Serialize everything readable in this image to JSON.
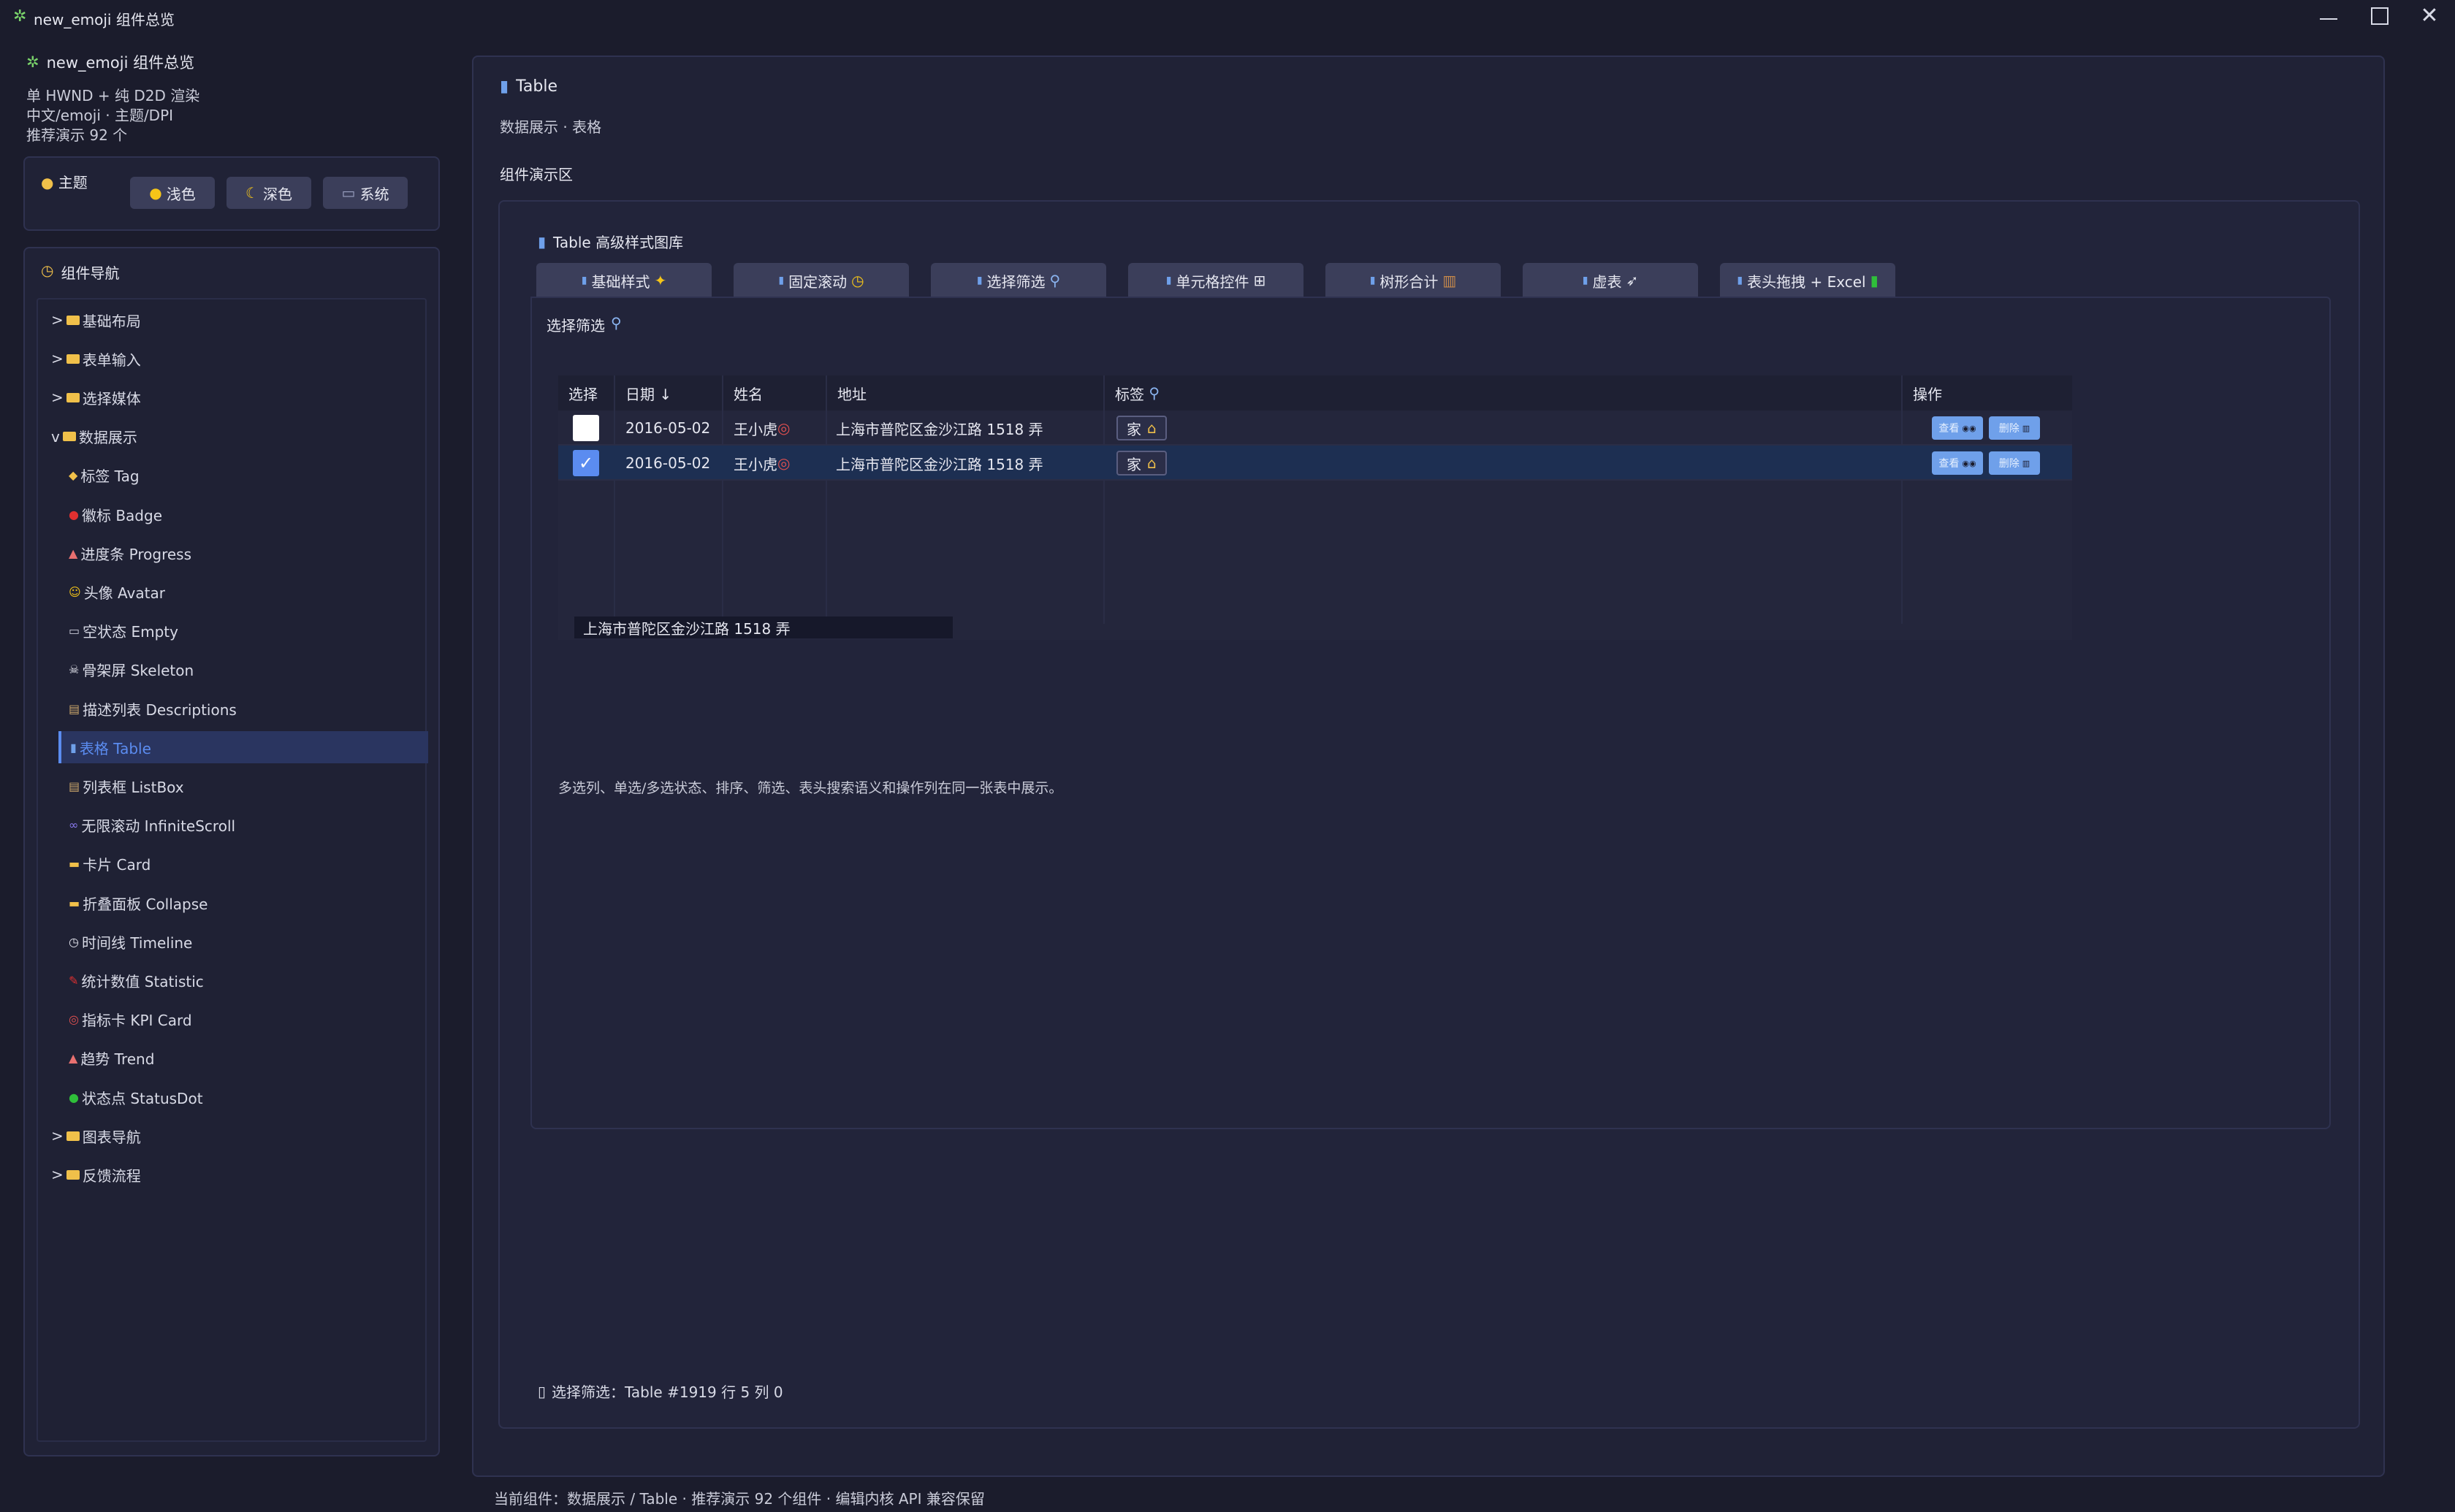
{
  "window": {
    "app_icon": "sparkle-icon",
    "title": "new_emoji 组件总览",
    "minimize": "minimize-icon",
    "maximize": "maximize-icon",
    "close": "close-icon"
  },
  "sidebar": {
    "app_name": "new_emoji 组件总览",
    "desc_lines": [
      "单 HWND + 纯 D2D 渲染",
      "中文/emoji · 主题/DPI",
      "推荐演示 92 个"
    ],
    "theme": {
      "label": "主题",
      "buttons": [
        "浅色",
        "深色",
        "系统"
      ]
    },
    "nav_header": "组件导航",
    "nav": [
      {
        "label": "基础布局",
        "prefix": ">"
      },
      {
        "label": "表单输入",
        "prefix": ">"
      },
      {
        "label": "选择媒体",
        "prefix": ">"
      },
      {
        "label": "数据展示",
        "prefix": "v"
      },
      {
        "label": "标签 Tag",
        "child": true,
        "icon": "tag-icon"
      },
      {
        "label": "徽标 Badge",
        "child": true,
        "icon": "red-dot-icon"
      },
      {
        "label": "进度条 Progress",
        "child": true,
        "icon": "chart-up-icon"
      },
      {
        "label": "头像 Avatar",
        "child": true,
        "icon": "smiley-icon"
      },
      {
        "label": "空状态 Empty",
        "child": true,
        "icon": "mailbox-icon"
      },
      {
        "label": "骨架屏 Skeleton",
        "child": true,
        "icon": "skull-icon"
      },
      {
        "label": "描述列表 Descriptions",
        "child": true,
        "icon": "clipboard-icon"
      },
      {
        "label": "表格 Table",
        "child": true,
        "icon": "bar-chart-icon",
        "active": true
      },
      {
        "label": "列表框 ListBox",
        "child": true,
        "icon": "clipboard-icon"
      },
      {
        "label": "无限滚动 InfiniteScroll",
        "child": true,
        "icon": "infinity-icon"
      },
      {
        "label": "卡片 Card",
        "child": true,
        "icon": "card-icon"
      },
      {
        "label": "折叠面板 Collapse",
        "child": true,
        "icon": "folder-icon"
      },
      {
        "label": "时间线 Timeline",
        "child": true,
        "icon": "clock-icon"
      },
      {
        "label": "统计数值 Statistic",
        "child": true,
        "icon": "pin-icon"
      },
      {
        "label": "指标卡 KPI Card",
        "child": true,
        "icon": "target-icon"
      },
      {
        "label": "趋势 Trend",
        "child": true,
        "icon": "chart-up-icon"
      },
      {
        "label": "状态点 StatusDot",
        "child": true,
        "icon": "green-dot-icon"
      },
      {
        "label": "图表导航",
        "prefix": ">"
      },
      {
        "label": "反馈流程",
        "prefix": ">"
      }
    ]
  },
  "main": {
    "title": "Table",
    "subtitle": "数据展示 · 表格",
    "demo_label": "组件演示区",
    "gallery_title": "Table 高级样式图库",
    "tabs": [
      {
        "label": "基础样式",
        "icon": "sparkles-icon"
      },
      {
        "label": "固定滚动",
        "icon": "clock-icon"
      },
      {
        "label": "选择筛选",
        "icon": "magnifier-icon"
      },
      {
        "label": "单元格控件",
        "icon": "grid-icon"
      },
      {
        "label": "树形合计",
        "icon": "abacus-icon"
      },
      {
        "label": "虚表",
        "icon": "rocket-icon"
      },
      {
        "label": "表头拖拽 + Excel",
        "icon": "green-book-icon"
      }
    ],
    "content_title": "选择筛选",
    "table": {
      "headers": [
        "选择",
        "日期 ↓",
        "姓名",
        "地址",
        "标签",
        "操作"
      ],
      "rows": [
        {
          "checked": false,
          "date": "2016-05-02",
          "name": "王小虎",
          "address": "上海市普陀区金沙江路 1518 弄",
          "tag": "家",
          "actions": [
            "查看",
            "删除"
          ]
        },
        {
          "checked": true,
          "date": "2016-05-02",
          "name": "王小虎",
          "address": "上海市普陀区金沙江路 1518 弄",
          "tag": "家",
          "actions": [
            "查看",
            "删除"
          ]
        }
      ],
      "tooltip": "上海市普陀区金沙江路 1518 弄"
    },
    "description": "多选列、单选/多选状态、排序、筛选、表头搜索语义和操作列在同一张表中展示。",
    "status": "选择筛选：Table #1919 行 5 列 0"
  },
  "footer": "当前组件：数据展示 / Table · 推荐演示 92 个组件 · 编辑内核 API 兼容保留",
  "colors": {
    "background": "#1b1c2c",
    "panel": "#202236",
    "accent": "#5b8cf0",
    "selected_row": "#1d2f52",
    "action_button": "#6fa0ea"
  }
}
